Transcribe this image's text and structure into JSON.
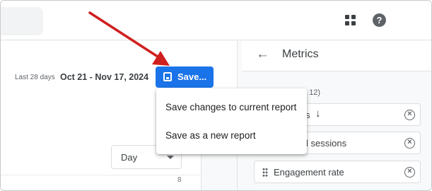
{
  "header": {
    "apps_icon": "apps-grid-icon",
    "help_icon": "help-circle-icon",
    "help_glyph": "?"
  },
  "report": {
    "date_label": "Last 28 days",
    "date_range": "Oct 21 - Nov 17, 2024",
    "save_button_label": "Save...",
    "save_icon": "floppy-disk-icon",
    "granularity_value": "Day",
    "axis_value": "8"
  },
  "save_menu": {
    "items": [
      {
        "label": "Save changes to current report"
      },
      {
        "label": "Save as a new report"
      }
    ]
  },
  "metrics_panel": {
    "back_icon": "arrow-left-icon",
    "back_glyph": "←",
    "title": "Metrics",
    "count_hint": "0 12)",
    "chips": [
      {
        "label": "s",
        "sort_glyph": "↓",
        "remove_glyph": "×"
      },
      {
        "label": "l sessions",
        "remove_glyph": "×"
      },
      {
        "label": "Engagement rate",
        "remove_glyph": "×"
      }
    ]
  },
  "annotation": {
    "arrow_color": "#d01f1f"
  },
  "colors": {
    "accent": "#1a73e8",
    "text": "#202124",
    "muted": "#5f6368"
  }
}
